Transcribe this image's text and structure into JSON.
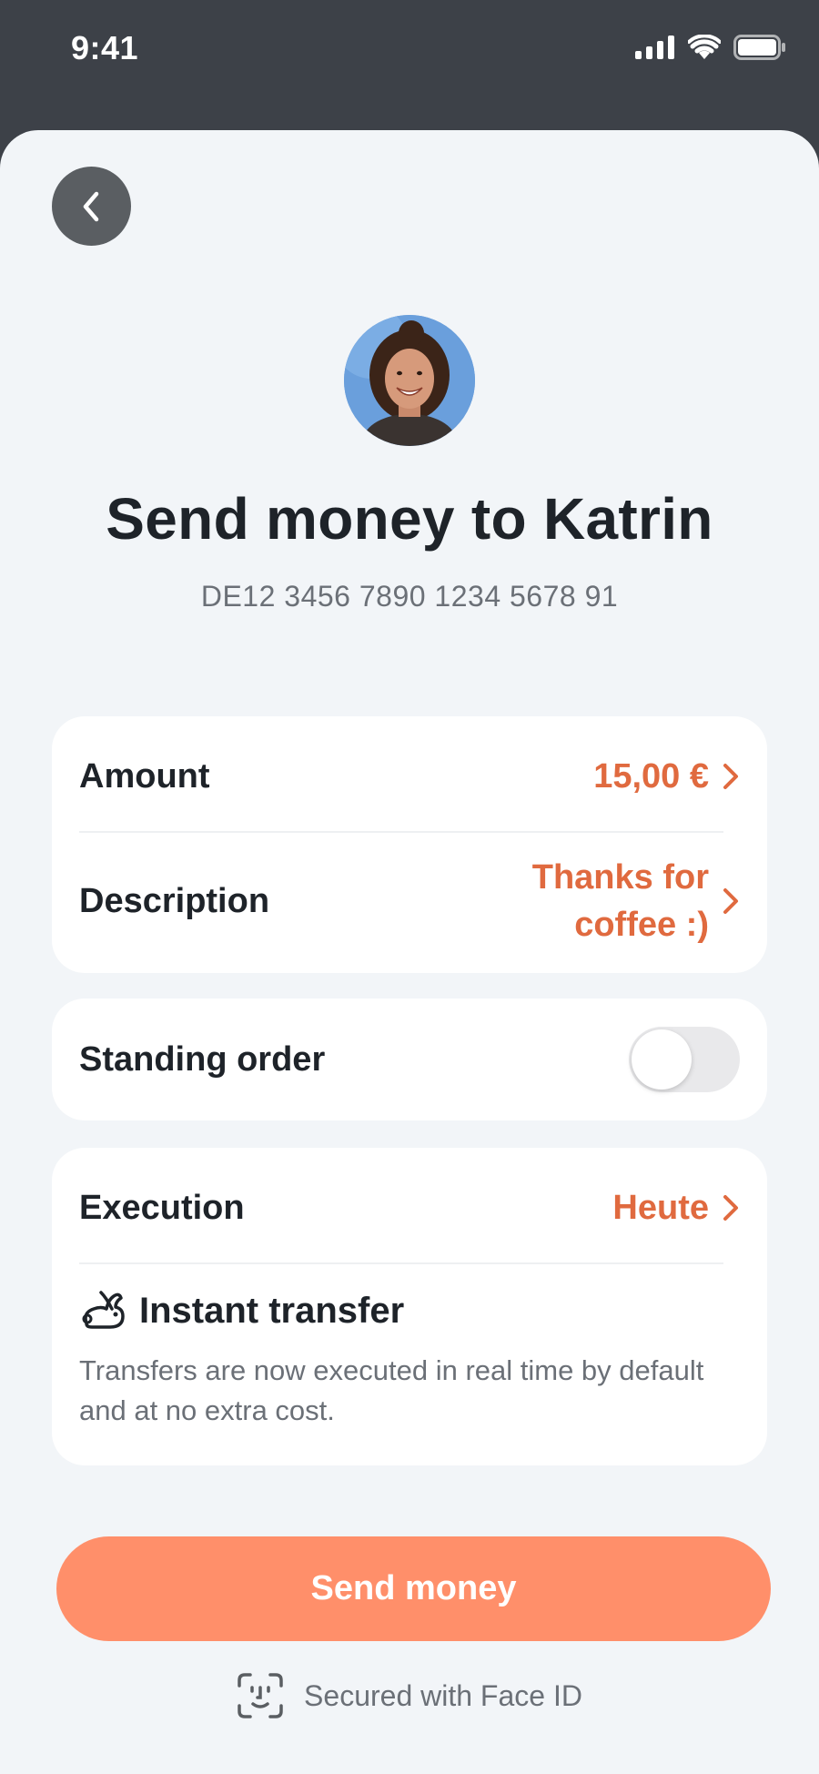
{
  "status_bar": {
    "time": "9:41",
    "icons": [
      "cellular-signal-icon",
      "wifi-icon",
      "battery-icon"
    ]
  },
  "header": {
    "back_icon": "chevron-left-icon"
  },
  "recipient": {
    "title": "Send money to Katrin",
    "iban": "DE12 3456 7890 1234 5678 91"
  },
  "details": {
    "amount_label": "Amount",
    "amount_value": "15,00 €",
    "description_label": "Description",
    "description_value_line1": "Thanks for",
    "description_value_line2": "coffee :)"
  },
  "standing_order": {
    "label": "Standing order",
    "enabled": false
  },
  "execution": {
    "label": "Execution",
    "value": "Heute",
    "instant_title": "Instant transfer",
    "instant_icon": "rabbit-icon",
    "instant_desc": "Transfers are now executed in real time by default and at no extra cost."
  },
  "actions": {
    "send_label": "Send money",
    "secured_text": "Secured with Face ID",
    "secured_icon": "face-id-icon"
  },
  "colors": {
    "accent": "#e06a3f",
    "button": "#ff8f6a",
    "background": "#f2f5f8",
    "status_bar": "#3d4148"
  }
}
